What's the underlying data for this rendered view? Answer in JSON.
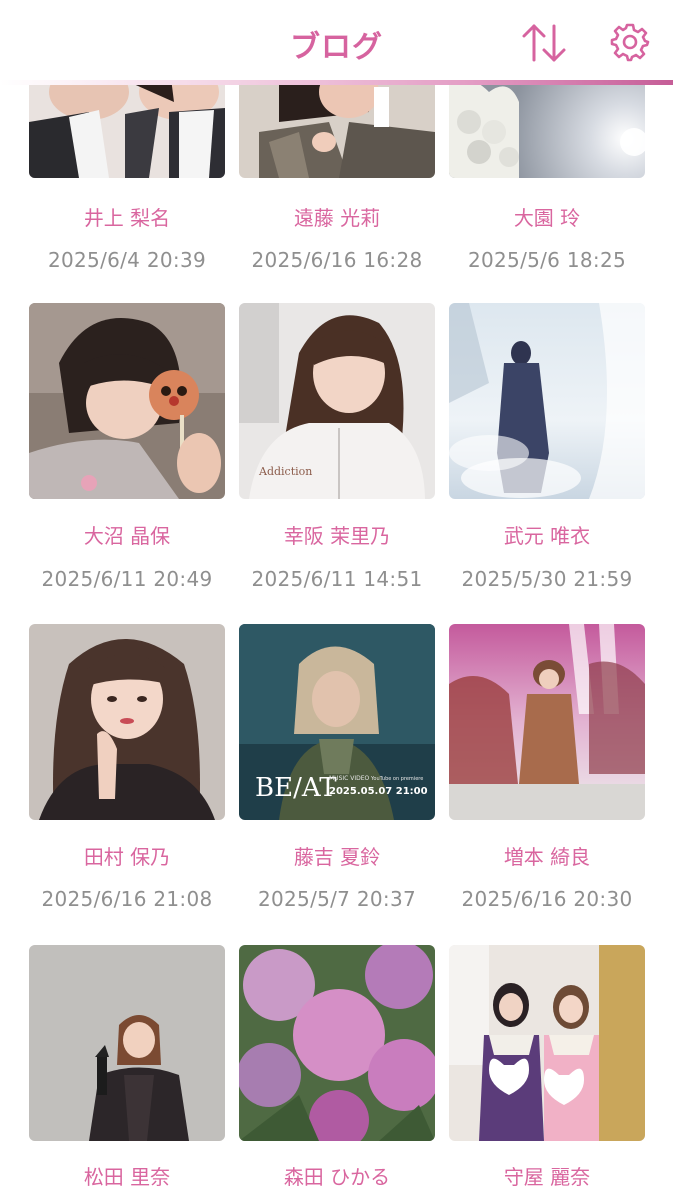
{
  "header": {
    "title": "ブログ",
    "sort_icon": "sort-arrows-icon",
    "settings_icon": "gear-icon",
    "accent_color": "#d6639f"
  },
  "posts": [
    {
      "name": "井上 梨名",
      "date": "2025/6/4 20:39"
    },
    {
      "name": "遠藤 光莉",
      "date": "2025/6/16 16:28"
    },
    {
      "name": "大園 玲",
      "date": "2025/5/6 18:25"
    },
    {
      "name": "大沼 晶保",
      "date": "2025/6/11 20:49"
    },
    {
      "name": "幸阪 茉里乃",
      "date": "2025/6/11 14:51"
    },
    {
      "name": "武元 唯衣",
      "date": "2025/5/30 21:59"
    },
    {
      "name": "田村 保乃",
      "date": "2025/6/16 21:08"
    },
    {
      "name": "藤吉 夏鈴",
      "date": "2025/5/7 20:37"
    },
    {
      "name": "増本 綺良",
      "date": "2025/6/16 20:30"
    },
    {
      "name": "松田 里奈",
      "date": ""
    },
    {
      "name": "森田 ひかる",
      "date": ""
    },
    {
      "name": "守屋 麗奈",
      "date": ""
    }
  ],
  "photo_texts": {
    "beat_title": "BE/AT",
    "beat_caption": "MUSIC VIDEO",
    "beat_premiere": "YouTube on premiere",
    "beat_date": "2025.05.07 21:00"
  }
}
